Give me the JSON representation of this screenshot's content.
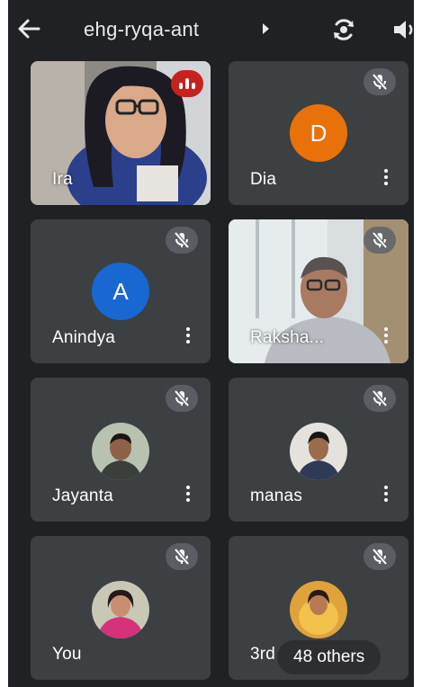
{
  "meeting": {
    "code": "ehg-ryqa-ant",
    "back_icon": "arrow-back-icon",
    "switch_camera_icon": "flip-camera-icon",
    "audio_icon": "speaker-icon"
  },
  "participants": [
    {
      "name": "Ira",
      "type": "video",
      "status": "speaking"
    },
    {
      "name": "Dia",
      "type": "letter",
      "initial": "D",
      "avatar_color": "#e8710a",
      "muted": true
    },
    {
      "name": "Anindya",
      "type": "letter",
      "initial": "A",
      "avatar_color": "#1967d2",
      "muted": true
    },
    {
      "name": "Raksha...",
      "type": "video",
      "muted": true
    },
    {
      "name": "Jayanta",
      "type": "photo",
      "muted": true
    },
    {
      "name": "manas",
      "type": "photo",
      "muted": true
    },
    {
      "name": "You",
      "type": "photo",
      "muted": true
    },
    {
      "name": "3rd",
      "type": "photo",
      "muted": true
    }
  ],
  "others_badge": "48 others"
}
